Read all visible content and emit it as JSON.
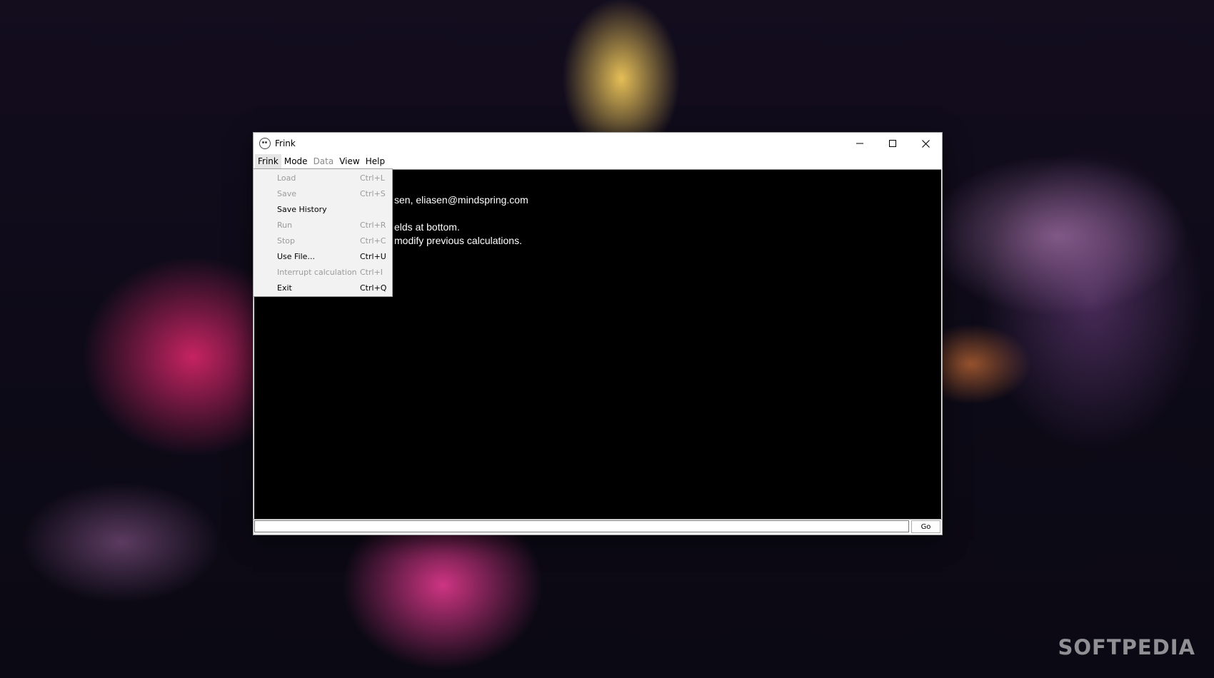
{
  "window": {
    "title": "Frink",
    "controls": {
      "minimize": "minimize-icon",
      "maximize": "maximize-icon",
      "close": "close-icon"
    }
  },
  "menubar": [
    {
      "label": "Frink",
      "enabled": true
    },
    {
      "label": "Mode",
      "enabled": true
    },
    {
      "label": "Data",
      "enabled": false
    },
    {
      "label": "View",
      "enabled": true
    },
    {
      "label": "Help",
      "enabled": true
    }
  ],
  "frink_menu": [
    {
      "label": "Load",
      "shortcut": "Ctrl+L",
      "enabled": false
    },
    {
      "label": "Save",
      "shortcut": "Ctrl+S",
      "enabled": false
    },
    {
      "label": "Save History",
      "shortcut": "",
      "enabled": true
    },
    {
      "label": "Run",
      "shortcut": "Ctrl+R",
      "enabled": false
    },
    {
      "label": "Stop",
      "shortcut": "Ctrl+C",
      "enabled": false
    },
    {
      "label": "Use File...",
      "shortcut": "Ctrl+U",
      "enabled": true
    },
    {
      "label": "Interrupt calculation",
      "shortcut": "Ctrl+I",
      "enabled": false
    },
    {
      "label": "Exit",
      "shortcut": "Ctrl+Q",
      "enabled": true
    }
  ],
  "output": {
    "lines": [
      "sen, eliasen@mindspring.com",
      "elds at bottom.",
      "modify previous calculations."
    ]
  },
  "input": {
    "value": "",
    "go_label": "Go"
  },
  "watermark": "SOFTPEDIA"
}
